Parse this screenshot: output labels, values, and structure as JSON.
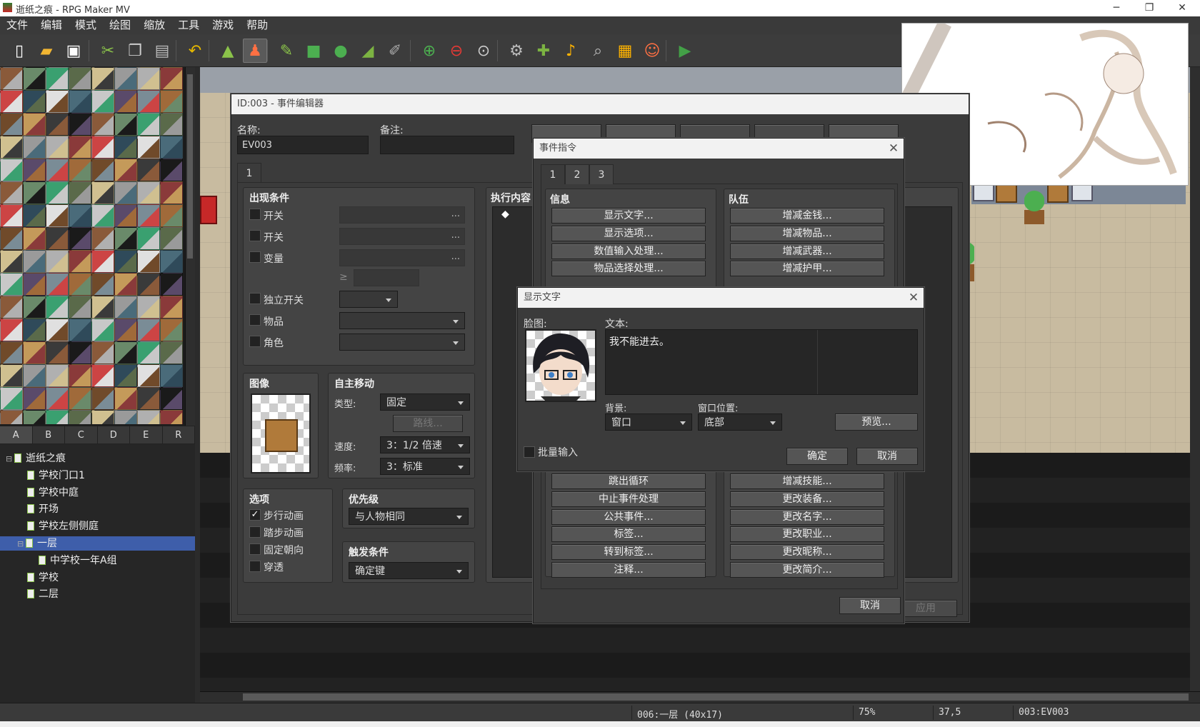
{
  "window": {
    "title": "逝纸之痕 - RPG Maker MV"
  },
  "menu": [
    "文件",
    "编辑",
    "模式",
    "绘图",
    "缩放",
    "工具",
    "游戏",
    "帮助"
  ],
  "toolbar": {
    "icons": [
      "new-project-icon",
      "open-project-icon",
      "save-project-icon",
      "cut-icon",
      "copy-icon",
      "paste-icon",
      "undo-icon",
      "map-mode-icon",
      "event-mode-icon",
      "pencil-icon",
      "rectangle-icon",
      "ellipse-icon",
      "fill-icon",
      "shadow-pen-icon",
      "zoom-in-icon",
      "zoom-out-icon",
      "actual-size-icon",
      "database-icon",
      "plugin-manager-icon",
      "sound-test-icon",
      "event-searcher-icon",
      "resource-manager-icon",
      "character-generator-icon",
      "playtest-icon"
    ]
  },
  "tileset_tabs": [
    "A",
    "B",
    "C",
    "D",
    "E",
    "R"
  ],
  "map_tree": [
    {
      "label": "逝纸之痕",
      "level": 0,
      "toggle": "⊟"
    },
    {
      "label": "学校门口1",
      "level": 1
    },
    {
      "label": "学校中庭",
      "level": 1
    },
    {
      "label": "开场",
      "level": 1
    },
    {
      "label": "学校左侧侧庭",
      "level": 1
    },
    {
      "label": "一层",
      "level": 1,
      "toggle": "⊟",
      "selected": true
    },
    {
      "label": "中学校一年A组",
      "level": 2
    },
    {
      "label": "学校",
      "level": 1
    },
    {
      "label": "二层",
      "level": 1
    }
  ],
  "statusbar": {
    "map": "006:一层 (40x17)",
    "zoom": "75%",
    "coords": "37,5",
    "event": "003:EV003"
  },
  "event_editor": {
    "title": "ID:003 - 事件编辑器",
    "name_label": "名称:",
    "name_value": "EV003",
    "note_label": "备注:",
    "note_value": "",
    "page_tab": "1",
    "conditions": {
      "title": "出现条件",
      "rows": [
        {
          "label": "开关",
          "kind": "field"
        },
        {
          "label": "开关",
          "kind": "field"
        },
        {
          "label": "变量",
          "kind": "field"
        },
        {
          "label": "≥",
          "kind": "spin"
        },
        {
          "label": "独立开关",
          "kind": "combo"
        },
        {
          "label": "物品",
          "kind": "combo"
        },
        {
          "label": "角色",
          "kind": "combo"
        }
      ],
      "ellipsis": "..."
    },
    "image": {
      "title": "图像"
    },
    "autonomous": {
      "title": "自主移动",
      "type_label": "类型:",
      "type_value": "固定",
      "route_button": "路线...",
      "speed_label": "速度:",
      "speed_value": "3：1/2 倍速",
      "freq_label": "频率:",
      "freq_value": "3：标准"
    },
    "options": {
      "title": "选项",
      "items": [
        {
          "label": "步行动画",
          "checked": true
        },
        {
          "label": "踏步动画",
          "checked": false
        },
        {
          "label": "固定朝向",
          "checked": false
        },
        {
          "label": "穿透",
          "checked": false
        }
      ],
      "check_mark": "✓"
    },
    "priority": {
      "title": "优先级",
      "value": "与人物相同"
    },
    "trigger": {
      "title": "触发条件",
      "value": "确定键"
    },
    "contents_title": "执行内容",
    "contents_bullet": "◆",
    "apply_button": "应用"
  },
  "event_commands": {
    "title": "事件指令",
    "tabs": [
      "1",
      "2",
      "3"
    ],
    "info_title": "信息",
    "info_top": [
      "显示文字...",
      "显示选项...",
      "数值输入处理...",
      "物品选择处理..."
    ],
    "info_bottom": [
      "跳出循环",
      "中止事件处理",
      "公共事件...",
      "标签...",
      "转到标签...",
      "注释..."
    ],
    "party_title": "队伍",
    "party_top": [
      "增减金钱...",
      "增减物品...",
      "增减武器...",
      "增减护甲..."
    ],
    "party_bottom": [
      "增减技能...",
      "更改装备...",
      "更改名字...",
      "更改职业...",
      "更改昵称...",
      "更改简介..."
    ],
    "cancel_button": "取消"
  },
  "show_text": {
    "title": "显示文字",
    "face_label": "脸图:",
    "text_label": "文本:",
    "text_value": "我不能进去。",
    "bg_label": "背景:",
    "bg_value": "窗口",
    "pos_label": "窗口位置:",
    "pos_value": "底部",
    "preview_button": "预览...",
    "batch_label": "批量输入",
    "ok_button": "确定",
    "cancel_button": "取消"
  },
  "close_glyph": "✕",
  "colors": {
    "accent_selection": "#3e5eaa",
    "dialog_bg": "#3b3b3b"
  }
}
